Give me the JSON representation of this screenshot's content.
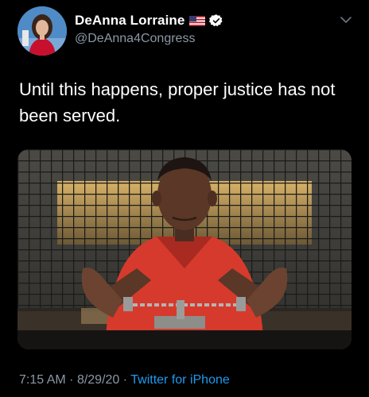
{
  "author": {
    "display_name": "DeAnna Lorraine",
    "handle": "@DeAnna4Congress",
    "flag_icon": "us-flag-icon",
    "verified_icon": "verified-badge-icon"
  },
  "tweet": {
    "text": "Until this happens, proper justice has not been served.",
    "time": "7:15 AM",
    "date": "8/29/20",
    "source": "Twitter for iPhone",
    "separator": "·"
  },
  "colors": {
    "background": "#000000",
    "secondary_text": "#8b98a5",
    "link": "#1d9bf0",
    "verified": "#ffffff"
  }
}
